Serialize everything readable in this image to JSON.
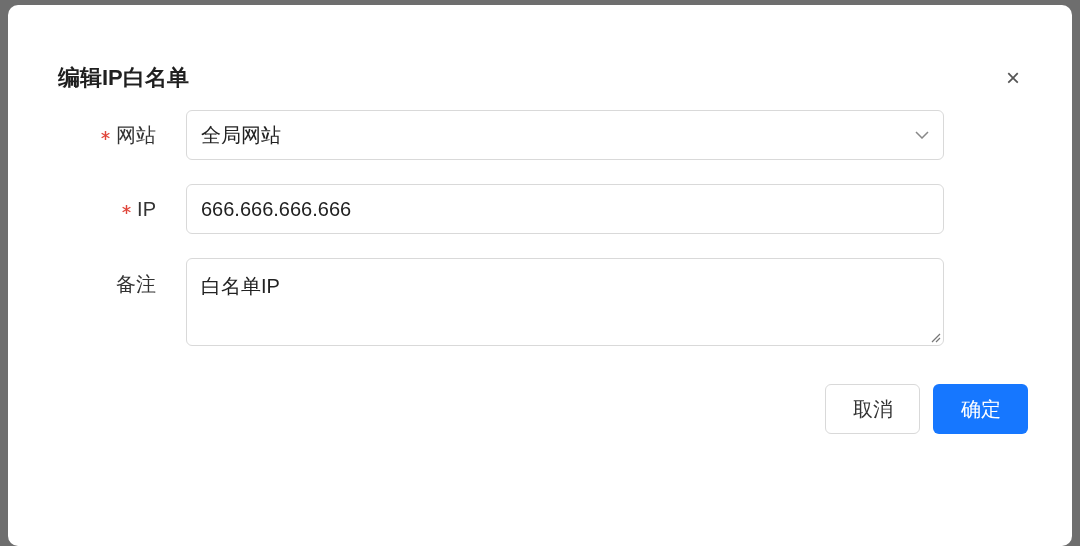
{
  "dialog": {
    "title": "编辑IP白名单",
    "close": "×"
  },
  "fields": [
    {
      "kind": "select",
      "label": "网站",
      "required": true,
      "value": "全局网站"
    },
    {
      "kind": "input",
      "label": "IP",
      "required": true,
      "value": "666.666.666.666"
    },
    {
      "kind": "textarea",
      "label": "备注",
      "required": false,
      "value": "白名单IP"
    }
  ],
  "buttons": [
    {
      "label": "取消",
      "primary": false
    },
    {
      "label": "确定",
      "primary": true
    }
  ]
}
